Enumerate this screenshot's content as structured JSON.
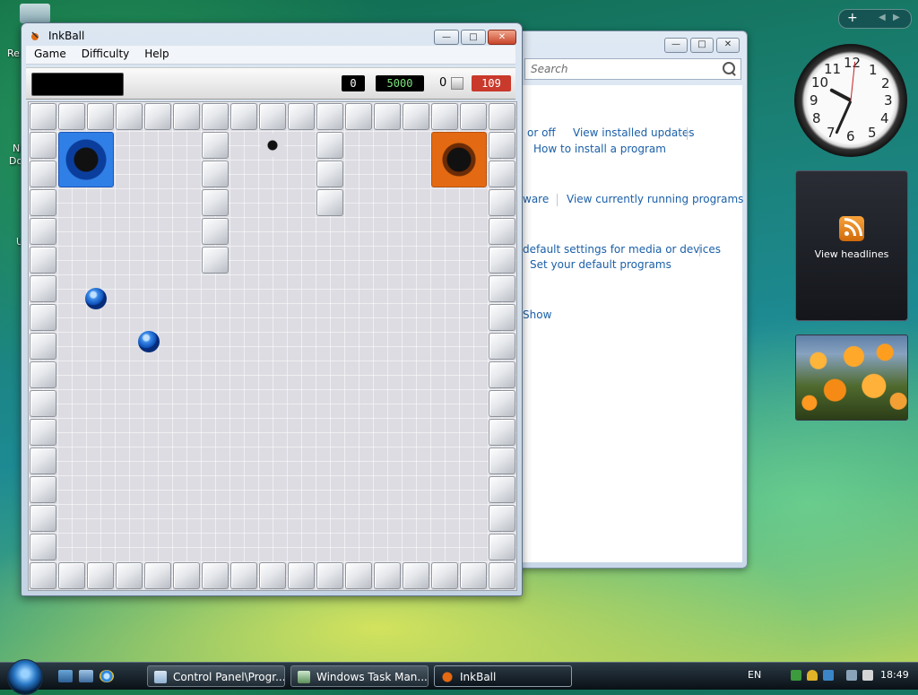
{
  "desktop": {
    "peek_labels": [
      "Re",
      "N",
      "Do",
      "U"
    ]
  },
  "control_panel": {
    "search_placeholder": "Search",
    "controls": {
      "minimize": "—",
      "maximize": "□",
      "close": "✕"
    },
    "links": [
      "or off",
      "View installed updates",
      "How to install a program",
      "ware",
      "View currently running programs",
      "default settings for media or devices",
      "Set your default programs",
      "Show"
    ]
  },
  "inkball": {
    "title": "InkBall",
    "menu": [
      "Game",
      "Difficulty",
      "Help"
    ],
    "controls": {
      "minimize": "—",
      "maximize": "□",
      "close": "✕"
    },
    "scores": {
      "score": "0",
      "bonus": "5000",
      "balls": "0",
      "time": "109"
    },
    "board": {
      "holes": [
        {
          "color": "blue"
        },
        {
          "color": "orange"
        },
        {
          "color": "gray"
        }
      ],
      "balls": [
        {
          "color": "blue"
        },
        {
          "color": "blue"
        }
      ]
    }
  },
  "sidebar": {
    "clock": {
      "numbers": [
        "12",
        "1",
        "2",
        "3",
        "4",
        "5",
        "6",
        "7",
        "8",
        "9",
        "10",
        "11"
      ]
    },
    "feed_label": "View headlines",
    "toolbar_plus": "+",
    "toolbar_prev": "◀",
    "toolbar_next": "▶"
  },
  "taskbar": {
    "tasks": [
      {
        "label": "Control Panel\\Progr..."
      },
      {
        "label": "Windows Task Man..."
      },
      {
        "label": "InkBall"
      }
    ],
    "language": "EN",
    "time": "18:49"
  },
  "colors": {
    "accent_blue": "#1a5fa8",
    "time_red": "#c9392c",
    "bonus_green": "#7be07b",
    "hole_blue": "#2f7fe6",
    "hole_orange": "#e36a12"
  }
}
